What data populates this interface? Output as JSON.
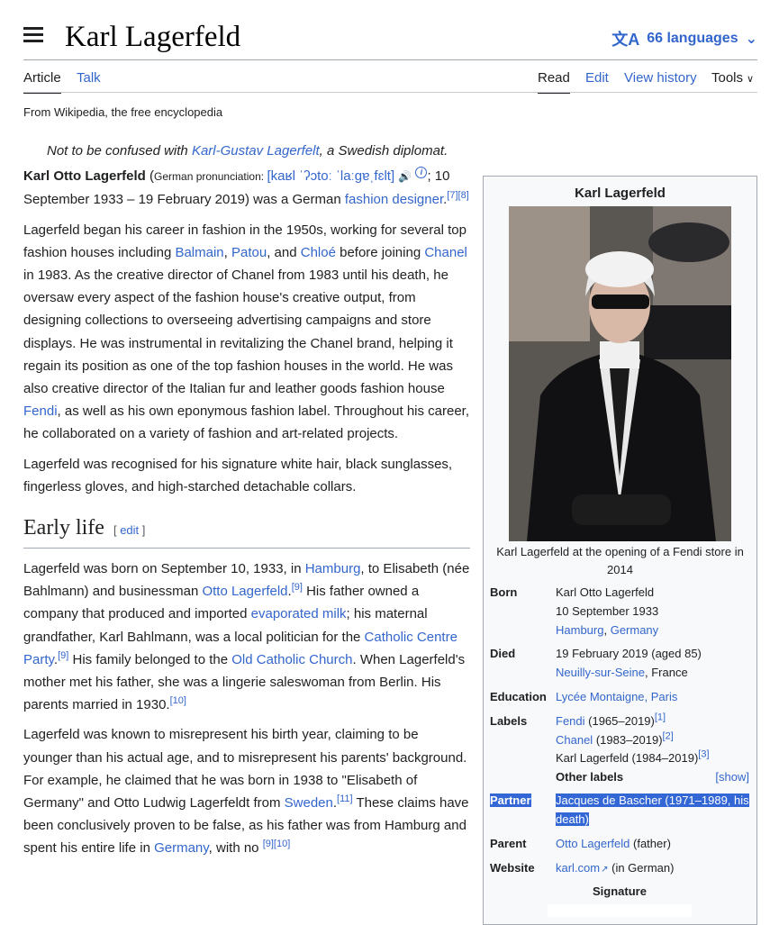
{
  "header": {
    "title": "Karl Lagerfeld",
    "languages": "66 languages"
  },
  "tabs": {
    "article": "Article",
    "talk": "Talk",
    "read": "Read",
    "edit": "Edit",
    "history": "View history",
    "tools": "Tools"
  },
  "tagline": "From Wikipedia, the free encyclopedia",
  "hatnote": {
    "pre": "Not to be confused with ",
    "link": "Karl-Gustav Lagerfelt",
    "post": ", a Swedish diplomat."
  },
  "intro": {
    "name": "Karl Otto Lagerfeld",
    "pron_label": "German pronunciation: ",
    "ipa": "[kaʁl ˈʔɔtoː ˈlaːɡɐˌfɛlt]",
    "semicolon": ";",
    "dates": " 10 September 1933 – 19 February 2019) was a German ",
    "fashion_link": "fashion designer",
    "refs": "[7][8]",
    "period": "."
  },
  "para2": {
    "t1": "Lagerfeld began his career in fashion in the 1950s, working for several top fashion houses including ",
    "balmain": "Balmain",
    "c1": ", ",
    "patou": "Patou",
    "c2": ", and ",
    "chloe": "Chloé",
    "t2": " before joining ",
    "chanel": "Chanel",
    "t3": " in 1983. As the creative director of Chanel from 1983 until his death, he oversaw every aspect of the fashion house's creative output, from designing collections to overseeing advertising campaigns and store displays. He was instrumental in revitalizing the Chanel brand, helping it regain its position as one of the top fashion houses in the world. He was also creative director of the Italian fur and leather goods fashion house ",
    "fendi": "Fendi",
    "t4": ", as well as his own eponymous fashion label. Throughout his career, he collaborated on a variety of fashion and art-related projects."
  },
  "para3": "Lagerfeld was recognised for his signature white hair, black sunglasses, fingerless gloves, and high-starched detachable collars.",
  "early_life": {
    "heading": "Early life",
    "edit": "[ edit ]",
    "p1": {
      "t1": "Lagerfeld was born on September 10, 1933, in ",
      "hamburg": "Hamburg",
      "t2": ", to Elisabeth (née Bahlmann) and businessman ",
      "otto": "Otto Lagerfeld",
      "dot1": ".",
      "ref9": "[9]",
      "t3": " His father owned a company that produced and imported ",
      "milk": "evaporated milk",
      "t4": "; his maternal grandfather, Karl Bahlmann, was a local politician for the ",
      "centre": "Catholic Centre Party",
      "dot2": ".",
      "ref9b": "[9]",
      "t5": " His family belonged to the ",
      "oldcath": "Old Catholic Church",
      "t6": ". When Lagerfeld's mother met his father, she was a lingerie saleswoman from Berlin. His parents married in 1930.",
      "ref10": "[10]"
    },
    "p2": {
      "t1": "Lagerfeld was known to misrepresent his birth year, claiming to be younger than his actual age, and to misrepresent his parents' background. For example, he claimed that he was born in 1938 to \"Elisabeth of Germany\" and Otto Ludwig Lagerfeldt from ",
      "sweden": "Sweden",
      "dot": ".",
      "ref11": "[11]",
      "t2": " These claims have been conclusively proven to be false, as his father was from Hamburg and spent his entire life in ",
      "germany": "Germany",
      "t3": ", with no",
      "tail_ref": "[9][10]"
    }
  },
  "infobox": {
    "title": "Karl Lagerfeld",
    "caption": "Karl Lagerfeld at the opening of a Fendi store in 2014",
    "born_label": "Born",
    "born_name": "Karl Otto Lagerfeld",
    "born_date": "10 September 1933",
    "born_city": "Hamburg",
    "born_sep": ", ",
    "born_country": "Germany",
    "died_label": "Died",
    "died_date": "19 February 2019 (aged 85)",
    "died_city": "Neuilly-sur-Seine",
    "died_country": ", France",
    "edu_label": "Education",
    "edu_val": "Lycée Montaigne, Paris",
    "labels_label": "Labels",
    "label1_link": "Fendi",
    "label1_years": " (1965–2019)",
    "label1_ref": "[1]",
    "label2_link": "Chanel",
    "label2_years": " (1983–2019)",
    "label2_ref": "[2]",
    "label3_text": "Karl Lagerfeld (1984–2019)",
    "label3_ref": "[3]",
    "other_labels": "Other labels",
    "show": "[show]",
    "partner_label": "Partner",
    "partner_val": "Jacques de Bascher (1971–1989, his death)",
    "parent_label": "Parent",
    "parent_link": "Otto Lagerfeld",
    "parent_rel": " (father)",
    "website_label": "Website",
    "website_link": "karl.com",
    "website_note": " (in German)",
    "signature": "Signature"
  }
}
